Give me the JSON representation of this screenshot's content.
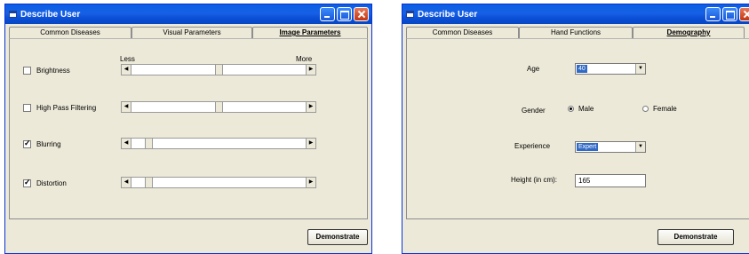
{
  "left_window": {
    "title": "Describe User",
    "tabs": [
      "Common Diseases",
      "Visual Parameters",
      "Image Parameters"
    ],
    "active_tab": "Image Parameters",
    "scale": {
      "min_label": "Less",
      "max_label": "More"
    },
    "rows": [
      {
        "label": "Brightness",
        "checked": false,
        "level_percent": 50
      },
      {
        "label": "High Pass Filtering",
        "checked": false,
        "level_percent": 50
      },
      {
        "label": "Blurring",
        "checked": true,
        "level_percent": 6
      },
      {
        "label": "Distortion",
        "checked": true,
        "level_percent": 6
      }
    ],
    "demonstrate_label": "Demonstrate"
  },
  "right_window": {
    "title": "Describe User",
    "tabs": [
      "Common Diseases",
      "Hand Functions",
      "Demography"
    ],
    "active_tab": "Demography",
    "age": {
      "label": "Age",
      "value": "40"
    },
    "gender": {
      "label": "Gender",
      "options": [
        "Male",
        "Female"
      ],
      "selected": "Male"
    },
    "experience": {
      "label": "Experience",
      "value": "Expert"
    },
    "height": {
      "label": "Height (in cm):",
      "value": "165"
    },
    "demonstrate_label": "Demonstrate"
  }
}
